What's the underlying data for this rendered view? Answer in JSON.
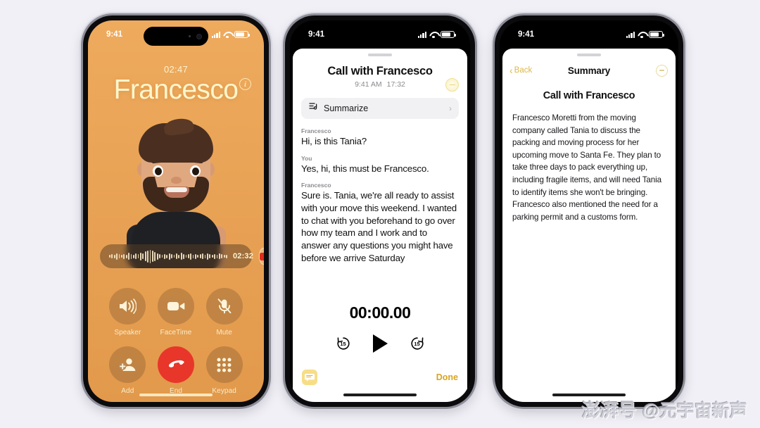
{
  "background_color": "#f1f0f7",
  "phone1": {
    "name": "call-screen",
    "status": {
      "time": "9:41",
      "signal": "cellular-signal-icon",
      "wifi": "wifi-icon",
      "battery": "battery-icon"
    },
    "call_duration": "02:47",
    "caller_name": "Francesco",
    "info_button": "i",
    "recorder": {
      "elapsed": "02:32",
      "record_button": "record-stop-button"
    },
    "buttons": [
      {
        "label": "Speaker",
        "icon": "speaker-icon"
      },
      {
        "label": "FaceTime",
        "icon": "video-camera-icon"
      },
      {
        "label": "Mute",
        "icon": "microphone-muted-icon"
      },
      {
        "label": "Add",
        "icon": "add-person-icon"
      },
      {
        "label": "End",
        "icon": "end-call-icon"
      },
      {
        "label": "Keypad",
        "icon": "keypad-icon"
      }
    ],
    "accent_color": "#e8362a",
    "screen_color": "#e9a356"
  },
  "phone2": {
    "name": "call-recording-transcript",
    "status": {
      "time": "9:41"
    },
    "title": "Call with Francesco",
    "time_label": "9:41 AM",
    "duration_label": "17:32",
    "summarize_label": "Summarize",
    "summarize_icon": "summarize-icon",
    "chevron": "›",
    "transcript": [
      {
        "speaker": "Francesco",
        "text": "Hi, is this Tania?",
        "faded": false
      },
      {
        "speaker": "You",
        "text": "Yes, hi, this must be Francesco.",
        "faded": false
      },
      {
        "speaker": "Francesco",
        "text": "Sure is. Tania, we're all ready to assist with your move this weekend. I wanted to chat with you beforehand to go over how my team and I work and to answer any questions you might have before we arrive Saturday",
        "faded": false
      }
    ],
    "player": {
      "timecode": "00:00.00",
      "skip_back": "15",
      "skip_forward": "15",
      "play_icon": "play-icon"
    },
    "transcript_icon": "transcript-bubble-icon",
    "done_label": "Done",
    "accent_color": "#d9a520"
  },
  "phone3": {
    "name": "call-summary",
    "status": {
      "time": "9:41"
    },
    "back_label": "Back",
    "nav_title": "Summary",
    "ai_icon": "apple-intelligence-icon",
    "summary_title": "Call with Francesco",
    "summary_body": "Francesco Moretti from the moving company called Tania to discuss the packing and moving process for her upcoming move to Santa Fe. They plan to take three days to pack everything up, including fragile items, and will need Tania to identify items she won't be bringing. Francesco also mentioned the need for a parking permit and a customs form.",
    "accent_color": "#dcb84a"
  },
  "watermark": {
    "brand": "澎湃号",
    "handle": "@元宇宙新声"
  }
}
